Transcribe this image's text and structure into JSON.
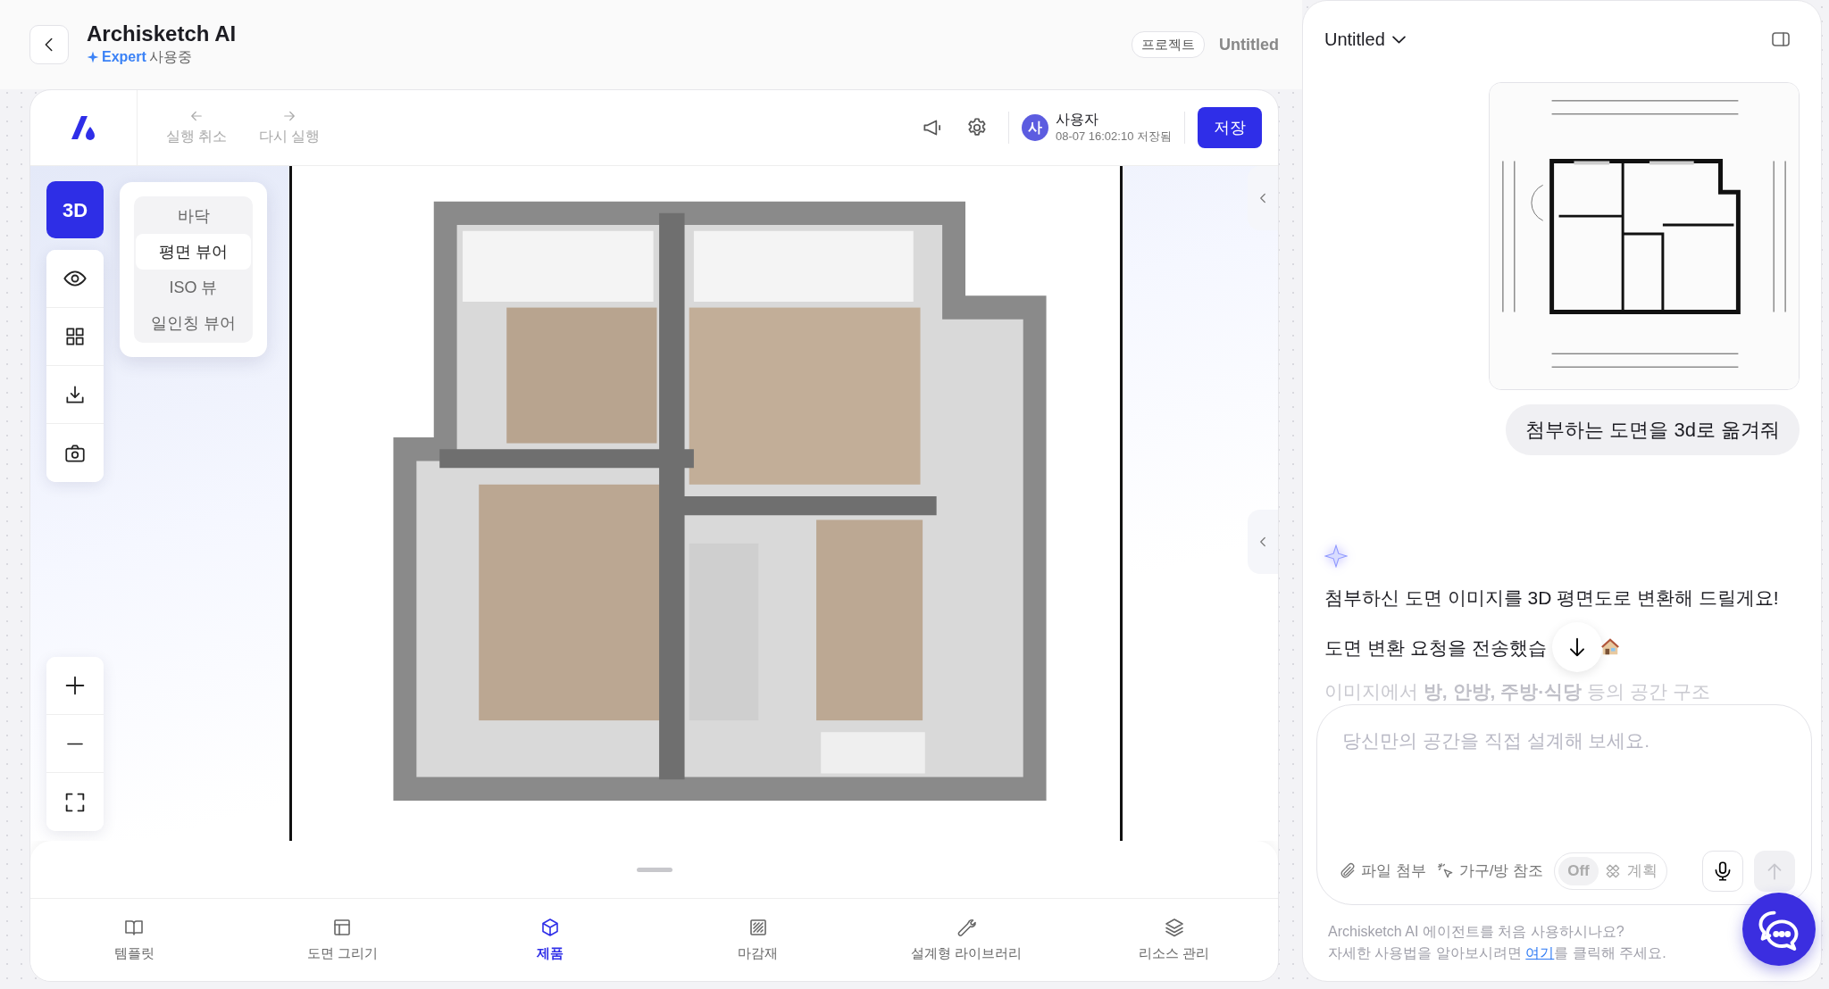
{
  "header": {
    "title": "Archisketch AI",
    "plan": "Expert",
    "plan_status": "사용중",
    "project_label": "프로젝트",
    "project_name": "Untitled"
  },
  "toolbar": {
    "undo": {
      "label": "실행 취소",
      "disabled": true
    },
    "redo": {
      "label": "다시 실행",
      "disabled": true
    },
    "user": {
      "avatar": "사",
      "name": "사용자",
      "saved": "08-07 16:02:10 저장됨"
    },
    "save": "저장"
  },
  "view_mode": {
    "button": "3D",
    "menu": [
      {
        "label": "바닥",
        "selected": false
      },
      {
        "label": "평면 뷰어",
        "selected": true
      },
      {
        "label": "ISO 뷰",
        "selected": false
      },
      {
        "label": "일인칭 뷰어",
        "selected": false
      }
    ]
  },
  "bottom_nav": [
    {
      "label": "템플릿",
      "selected": false
    },
    {
      "label": "도면 그리기",
      "selected": false
    },
    {
      "label": "제품",
      "selected": true
    },
    {
      "label": "마감재",
      "selected": false
    },
    {
      "label": "설계형 라이브러리",
      "selected": false
    },
    {
      "label": "리소스 관리",
      "selected": false
    }
  ],
  "chat": {
    "title": "Untitled",
    "user_message": "첨부하는 도면을 3d로 옮겨줘",
    "assistant_lines": [
      "첨부하신 도면 이미지를 3D 평면도로 변환해 드릴게요!",
      "도면 변환 요청을 전송했습"
    ],
    "faded_line": "이미지에서 **방, 안방, 주방·식당** 등의 공간 구조"
  },
  "composer": {
    "placeholder": "당신만의 공간을 직접 설계해 보세요.",
    "attach": "파일 첨부",
    "reference": "가구/방 참조",
    "plan_toggle": {
      "state": "Off",
      "label": "계획",
      "on": false
    },
    "send": {
      "disabled": true
    }
  },
  "footer": {
    "question": "Archisketch AI 에이전트를 처음 사용하시나요?",
    "help_before": "자세한 사용법을 알아보시려면 ",
    "help_link": "여기",
    "help_after": "를 클릭해 주세요."
  }
}
